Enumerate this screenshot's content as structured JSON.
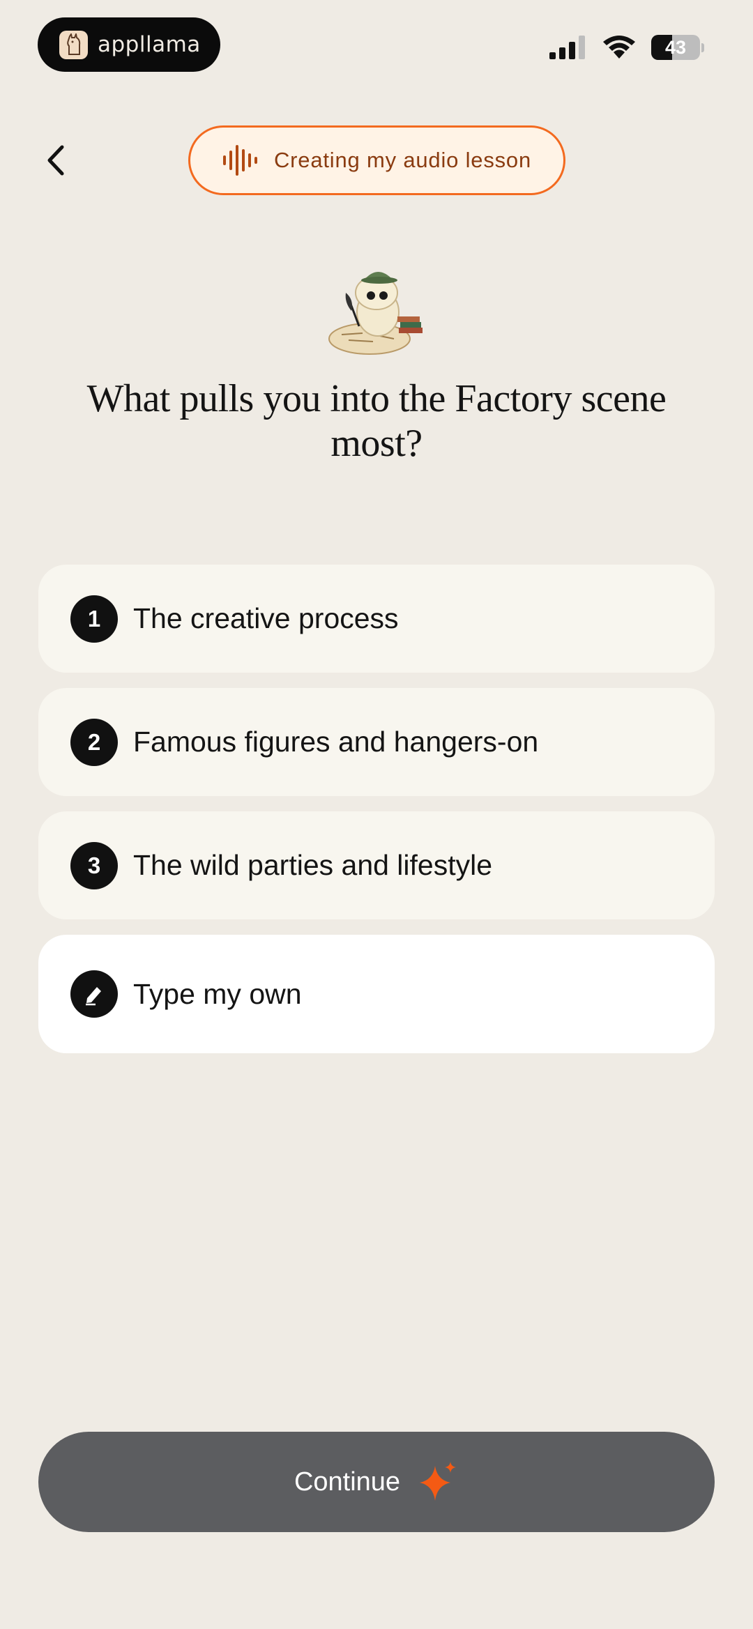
{
  "status_bar": {
    "app_name": "appllama",
    "battery": "43"
  },
  "header": {
    "chip_label": "Creating my audio lesson",
    "accent": "#f36a1f"
  },
  "question": "What pulls you into the Factory scene most?",
  "options": [
    {
      "badge": "1",
      "label": "The creative process"
    },
    {
      "badge": "2",
      "label": "Famous figures and hangers-on"
    },
    {
      "badge": "3",
      "label": "The wild parties and lifestyle"
    }
  ],
  "own_option": {
    "label": "Type my own",
    "icon": "pencil-icon"
  },
  "continue": {
    "label": "Continue",
    "icon": "sparkle-icon",
    "icon_color": "#f45a14"
  }
}
